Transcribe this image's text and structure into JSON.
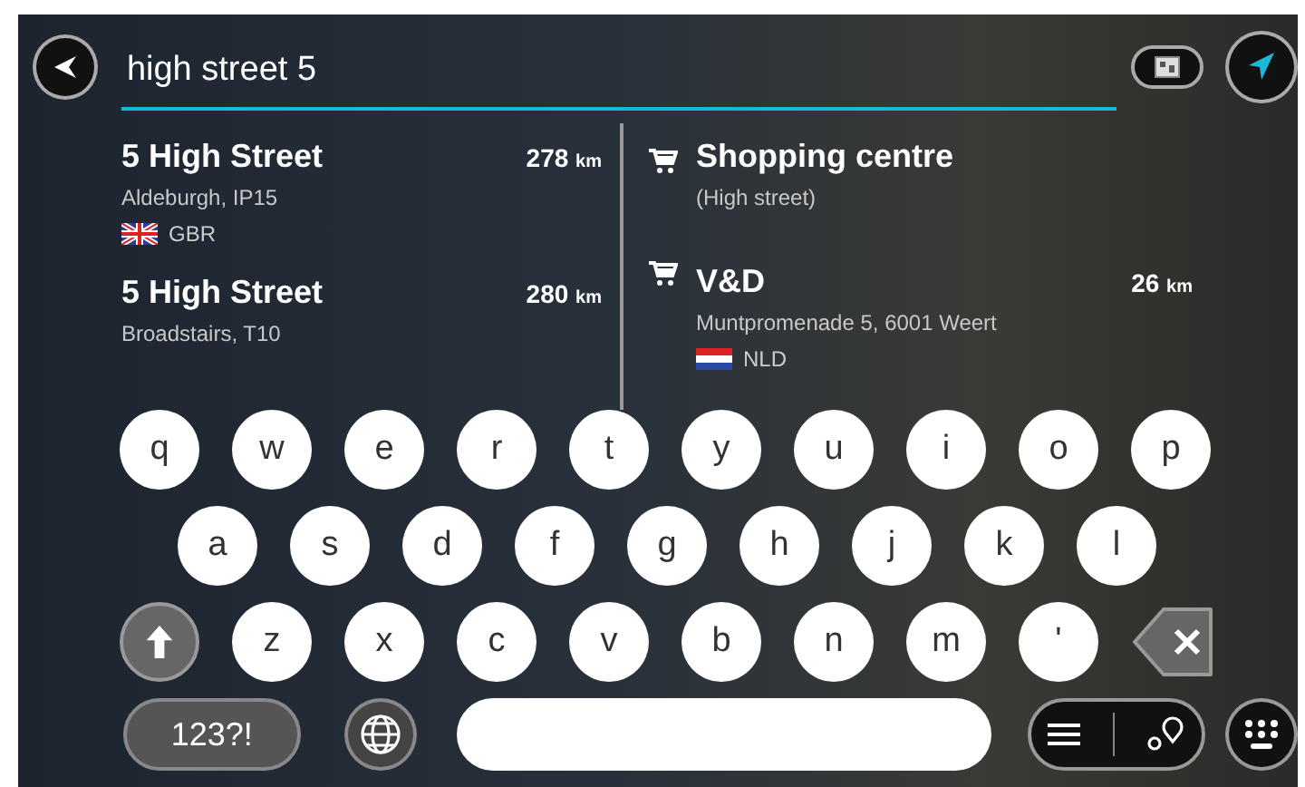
{
  "search": {
    "value": "high street 5"
  },
  "results_left": [
    {
      "title": "5 High Street",
      "subtitle": "Aldeburgh, IP15",
      "distance": "278",
      "unit": "km",
      "country": {
        "label": "GBR",
        "kind": "unionjack"
      }
    },
    {
      "title": "5 High Street",
      "subtitle": "Broadstairs,  T10",
      "distance": "280",
      "unit": "km"
    }
  ],
  "results_right": [
    {
      "kind": "category",
      "title": "Shopping centre",
      "subtitle": "(High street)"
    },
    {
      "kind": "poi",
      "title": "V&D",
      "subtitle": "Muntpromenade 5, 6001 Weert",
      "distance": "26",
      "unit": "km",
      "country": {
        "label": "NLD",
        "kind": "tricolour"
      }
    }
  ],
  "keyboard": {
    "rows": [
      [
        {
          "kind": "letter",
          "label": "q"
        },
        {
          "kind": "letter",
          "label": "w"
        },
        {
          "kind": "letter",
          "label": "e"
        },
        {
          "kind": "letter",
          "label": "r"
        },
        {
          "kind": "letter",
          "label": "t"
        },
        {
          "kind": "letter",
          "label": "y"
        },
        {
          "kind": "letter",
          "label": "u"
        },
        {
          "kind": "letter",
          "label": "i"
        },
        {
          "kind": "letter",
          "label": "o"
        },
        {
          "kind": "letter",
          "label": "p"
        }
      ],
      [
        {
          "kind": "letter",
          "label": "a"
        },
        {
          "kind": "letter",
          "label": "s"
        },
        {
          "kind": "letter",
          "label": "d"
        },
        {
          "kind": "letter",
          "label": "f"
        },
        {
          "kind": "letter",
          "label": "g"
        },
        {
          "kind": "letter",
          "label": "h"
        },
        {
          "kind": "letter",
          "label": "j"
        },
        {
          "kind": "letter",
          "label": "k"
        },
        {
          "kind": "letter",
          "label": "l"
        }
      ],
      [
        {
          "kind": "shift"
        },
        {
          "kind": "letter",
          "label": "z"
        },
        {
          "kind": "letter",
          "label": "x"
        },
        {
          "kind": "letter",
          "label": "c"
        },
        {
          "kind": "letter",
          "label": "v"
        },
        {
          "kind": "letter",
          "label": "b"
        },
        {
          "kind": "letter",
          "label": "n"
        },
        {
          "kind": "letter",
          "label": "m"
        },
        {
          "kind": "letter",
          "label": "'"
        },
        {
          "kind": "backspace"
        }
      ]
    ],
    "mode_key": "123?!"
  }
}
